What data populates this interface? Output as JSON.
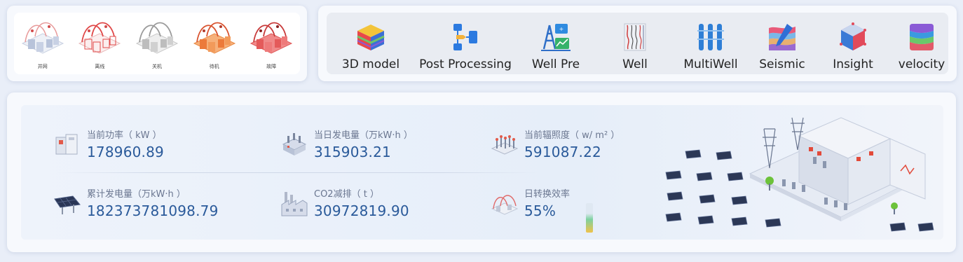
{
  "status_legend": {
    "items": [
      {
        "label": "并网",
        "color": "#a7b3cc"
      },
      {
        "label": "离线",
        "color": "#e45a5a"
      },
      {
        "label": "关机",
        "color": "#a3a3a3"
      },
      {
        "label": "待机",
        "color": "#f08a3a"
      },
      {
        "label": "故障",
        "color": "#e24b4b"
      }
    ]
  },
  "app_bar": {
    "items": [
      {
        "label": "3D model",
        "icon": "3d-model-icon"
      },
      {
        "label": "Post Processing",
        "icon": "post-processing-icon"
      },
      {
        "label": "Well Pre",
        "icon": "well-pre-icon"
      },
      {
        "label": "Well",
        "icon": "well-icon"
      },
      {
        "label": "MultiWell",
        "icon": "multiwell-icon"
      },
      {
        "label": "Seismic",
        "icon": "seismic-icon"
      },
      {
        "label": "Insight",
        "icon": "insight-icon"
      },
      {
        "label": "velocity",
        "icon": "velocity-icon"
      }
    ]
  },
  "metrics": {
    "power": {
      "label": "当前功率（ kW ）",
      "value": "178960.89"
    },
    "daily_energy": {
      "label": "当日发电量（万kW·h ）",
      "value": "315903.21"
    },
    "irradiance": {
      "label": "当前辐照度（ w/ m² ）",
      "value": "591087.22"
    },
    "total_energy": {
      "label": "累计发电量（万kW·h ）",
      "value": "182373781098.79"
    },
    "co2": {
      "label": "CO2减排（ t ）",
      "value": "30972819.90"
    },
    "efficiency": {
      "label": "日转换效率",
      "value": "55%",
      "fraction": 0.55
    }
  },
  "colors": {
    "value_blue": "#2a5a9a",
    "label_gray": "#6a7690"
  }
}
